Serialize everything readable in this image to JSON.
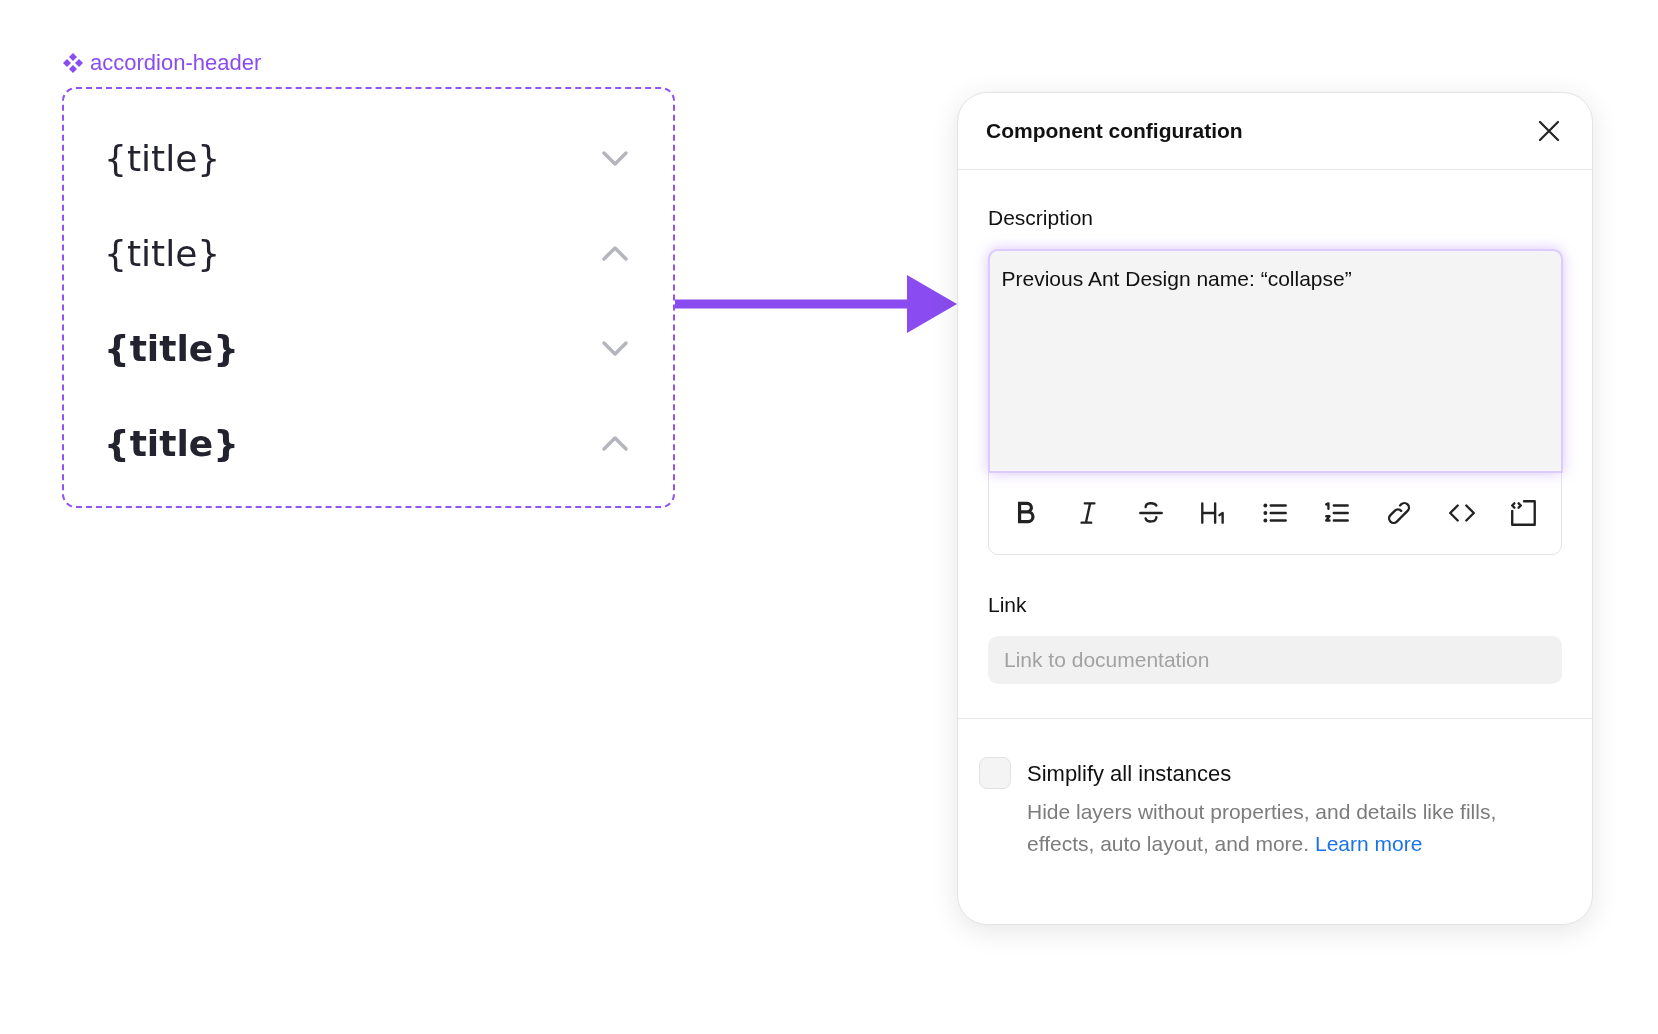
{
  "component": {
    "label": "accordion-header",
    "rows": [
      {
        "title": "{title}",
        "bold": false,
        "expanded": false
      },
      {
        "title": "{title}",
        "bold": false,
        "expanded": true
      },
      {
        "title": "{title}",
        "bold": true,
        "expanded": false
      },
      {
        "title": "{title}",
        "bold": true,
        "expanded": true
      }
    ]
  },
  "panel": {
    "title": "Component configuration",
    "description": {
      "label": "Description",
      "value": "Previous Ant Design name: “collapse”",
      "toolbar": [
        {
          "kind": "bold"
        },
        {
          "kind": "italic"
        },
        {
          "kind": "strike"
        },
        {
          "kind": "heading"
        },
        {
          "kind": "bullets"
        },
        {
          "kind": "numbers"
        },
        {
          "kind": "link"
        },
        {
          "kind": "code"
        },
        {
          "kind": "codeblock"
        }
      ]
    },
    "link": {
      "label": "Link",
      "placeholder": "Link to documentation"
    },
    "simplify": {
      "label": "Simplify all instances",
      "checked": false,
      "hint": "Hide layers without properties, and details like fills, effects, auto layout, and more.",
      "link": "Learn more"
    }
  }
}
